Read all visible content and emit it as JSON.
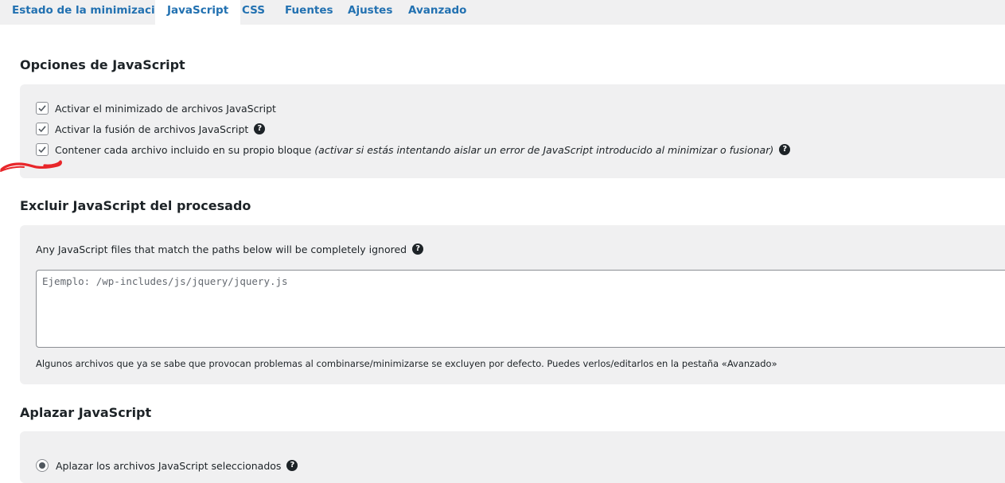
{
  "tabs": [
    {
      "label": "Estado de la minimización",
      "active": false
    },
    {
      "label": "JavaScript",
      "active": true
    },
    {
      "label": "CSS",
      "active": false
    },
    {
      "label": "Fuentes",
      "active": false
    },
    {
      "label": "Ajustes",
      "active": false
    },
    {
      "label": "Avanzado",
      "active": false
    }
  ],
  "js_options": {
    "title": "Opciones de JavaScript",
    "options": [
      {
        "label": "Activar el minimizado de archivos JavaScript",
        "checked": true,
        "help": false
      },
      {
        "label": "Activar la fusión de archivos JavaScript",
        "checked": true,
        "help": true
      },
      {
        "label": "Contener cada archivo incluido en su propio bloque",
        "note": "(activar si estás intentando aislar un error de JavaScript introducido al minimizar o fusionar)",
        "checked": true,
        "help": true
      }
    ]
  },
  "exclude": {
    "title": "Excluir JavaScript del procesado",
    "description": "Any JavaScript files that match the paths below will be completely ignored",
    "textarea_placeholder": "Ejemplo: /wp-includes/js/jquery/jquery.js",
    "textarea_value": "",
    "footnote": "Algunos archivos que ya se sabe que provocan problemas al combinarse/minimizarse se excluyen por defecto. Puedes verlos/editarlos en la pestaña «Avanzado»"
  },
  "defer": {
    "title": "Aplazar JavaScript",
    "option_label": "Aplazar los archivos JavaScript seleccionados",
    "selected": true
  },
  "help_icon_glyph": "?",
  "colors": {
    "tab_link": "#2271b1",
    "panel_bg": "#f0f0f1",
    "annotation_red": "#e8262a"
  }
}
